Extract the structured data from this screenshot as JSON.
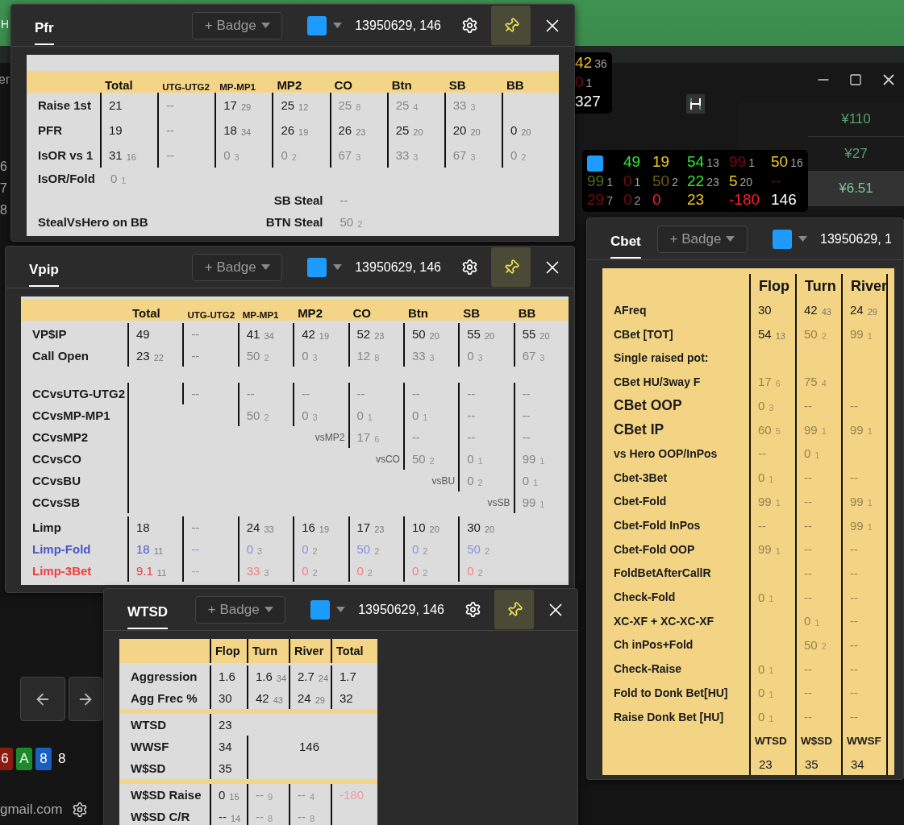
{
  "background": {
    "app_letter": "H",
    "menu_fragment": "er",
    "row_numbers": [
      "6",
      "7",
      "8"
    ],
    "mini_hud": [
      {
        "v": "42",
        "n": "36",
        "color": "#f2c81c"
      },
      {
        "v": "0",
        "n": "1",
        "color": "#8a0c0c"
      },
      {
        "v": "327",
        "color": "#ffffff"
      }
    ],
    "prices": [
      {
        "text": "¥110",
        "selected": false
      },
      {
        "text": "¥27",
        "selected": false
      },
      {
        "text": "¥6.51",
        "selected": true
      }
    ],
    "hud": {
      "rows": [
        [
          {
            "kind": "swatch",
            "color": "#1e9bff"
          },
          {
            "v": "49",
            "color": "#2ee82e"
          },
          {
            "v": "19",
            "color": "#f2c81c"
          },
          {
            "v": "54",
            "n": "13",
            "color": "#2ee82e"
          },
          {
            "v": "99",
            "n": "1",
            "color": "#7a0a0a"
          },
          {
            "v": "50",
            "n": "16",
            "color": "#f2c81c"
          }
        ],
        [
          {
            "v": "99",
            "n": "1",
            "color": "#4d7314"
          },
          {
            "v": "0",
            "n": "1",
            "color": "#7a0a0a"
          },
          {
            "v": "50",
            "n": "2",
            "color": "#6e5e12"
          },
          {
            "v": "22",
            "n": "23",
            "color": "#2ee82e"
          },
          {
            "v": "5",
            "n": "20",
            "color": "#f2c81c"
          },
          {
            "v": "--",
            "color": "#7a0a0a"
          }
        ],
        [
          {
            "v": "29",
            "n": "7",
            "color": "#7a0a0a"
          },
          {
            "v": "0",
            "n": "2",
            "color": "#7a0a0a"
          },
          {
            "v": "0",
            "color": "#ff2020"
          },
          {
            "v": "23",
            "color": "#f2c81c"
          },
          {
            "v": "-180",
            "color": "#ff2020"
          },
          {
            "v": "146",
            "color": "#ffffff"
          }
        ]
      ]
    },
    "cards": [
      {
        "rank": "6",
        "color": "#8b1a10"
      },
      {
        "rank": "A",
        "color": "#1a8a2a"
      },
      {
        "rank": "8",
        "color": "#1a5fc0"
      }
    ],
    "card_count": "8",
    "email": "gmail.com"
  },
  "panels": [
    {
      "kind": "positions",
      "title": "Pfr",
      "badge": "+ Badge",
      "color": "#1e9bff",
      "id_text": "13950629, 146",
      "pinned": true,
      "table": {
        "columns": [
          "Total",
          "UTG-UTG2",
          "MP-MP1",
          "MP2",
          "CO",
          "Btn",
          "SB",
          "BB"
        ],
        "groups": [
          {
            "rows": [
              {
                "label": "Raise 1st",
                "color": "#1a1a1a",
                "cells": [
                  {
                    "kind": "stat",
                    "v": "21",
                    "dim": false
                  },
                  {
                    "kind": "stat",
                    "v": "--",
                    "dim": true
                  },
                  {
                    "kind": "stat",
                    "v": "17",
                    "n": "29",
                    "dim": false
                  },
                  {
                    "kind": "stat",
                    "v": "25",
                    "n": "12",
                    "dim": false
                  },
                  {
                    "kind": "stat",
                    "v": "25",
                    "n": "8",
                    "dim": true
                  },
                  {
                    "kind": "stat",
                    "v": "25",
                    "n": "4",
                    "dim": true
                  },
                  {
                    "kind": "stat",
                    "v": "33",
                    "n": "3",
                    "dim": true
                  },
                  {
                    "kind": "blank"
                  }
                ]
              },
              {
                "label": "PFR",
                "color": "#1a1a1a",
                "cells": [
                  {
                    "kind": "stat",
                    "v": "19",
                    "dim": false
                  },
                  {
                    "kind": "stat",
                    "v": "--",
                    "dim": true
                  },
                  {
                    "kind": "stat",
                    "v": "18",
                    "n": "34",
                    "dim": false
                  },
                  {
                    "kind": "stat",
                    "v": "26",
                    "n": "19",
                    "dim": false
                  },
                  {
                    "kind": "stat",
                    "v": "26",
                    "n": "23",
                    "dim": false
                  },
                  {
                    "kind": "stat",
                    "v": "25",
                    "n": "20",
                    "dim": false
                  },
                  {
                    "kind": "stat",
                    "v": "20",
                    "n": "20",
                    "dim": false
                  },
                  {
                    "kind": "stat",
                    "v": "0",
                    "n": "20",
                    "dim": false
                  }
                ]
              },
              {
                "label": "IsOR vs 1",
                "color": "#1a1a1a",
                "cells": [
                  {
                    "kind": "stat",
                    "v": "31",
                    "n": "16",
                    "dim": false
                  },
                  {
                    "kind": "stat",
                    "v": "--",
                    "dim": true
                  },
                  {
                    "kind": "stat",
                    "v": "0",
                    "n": "3",
                    "dim": true
                  },
                  {
                    "kind": "stat",
                    "v": "0",
                    "n": "2",
                    "dim": true
                  },
                  {
                    "kind": "stat",
                    "v": "67",
                    "n": "3",
                    "dim": true
                  },
                  {
                    "kind": "stat",
                    "v": "33",
                    "n": "3",
                    "dim": true
                  },
                  {
                    "kind": "stat",
                    "v": "67",
                    "n": "3",
                    "dim": true
                  },
                  {
                    "kind": "stat",
                    "v": "0",
                    "n": "2",
                    "dim": true
                  }
                ]
              }
            ]
          }
        ],
        "extras": [
          {
            "left": {
              "label": "IsOR/Fold",
              "v": "0",
              "n": "1",
              "dim": true
            }
          },
          {
            "right": {
              "label": "SB Steal",
              "v": "--",
              "dim": true
            }
          },
          {
            "left": {
              "label": "StealVsHero on BB"
            },
            "right": {
              "label": "BTN Steal",
              "v": "50",
              "n": "2",
              "dim": true
            }
          }
        ]
      }
    },
    {
      "kind": "positions",
      "title": "Vpip",
      "badge": "+ Badge",
      "color": "#1e9bff",
      "id_text": "13950629, 146",
      "pinned": true,
      "table": {
        "columns": [
          "Total",
          "UTG-UTG2",
          "MP-MP1",
          "MP2",
          "CO",
          "Btn",
          "SB",
          "BB"
        ],
        "groups": [
          {
            "rows": [
              {
                "label": "VP$IP",
                "color": "#1a1a1a",
                "cells": [
                  {
                    "kind": "stat",
                    "v": "49",
                    "dim": false
                  },
                  {
                    "kind": "stat",
                    "v": "--",
                    "dim": true
                  },
                  {
                    "kind": "stat",
                    "v": "41",
                    "n": "34",
                    "dim": false
                  },
                  {
                    "kind": "stat",
                    "v": "42",
                    "n": "19",
                    "dim": false
                  },
                  {
                    "kind": "stat",
                    "v": "52",
                    "n": "23",
                    "dim": false
                  },
                  {
                    "kind": "stat",
                    "v": "50",
                    "n": "20",
                    "dim": false
                  },
                  {
                    "kind": "stat",
                    "v": "55",
                    "n": "20",
                    "dim": false
                  },
                  {
                    "kind": "stat",
                    "v": "55",
                    "n": "20",
                    "dim": false
                  }
                ]
              },
              {
                "label": "Call Open",
                "color": "#1a1a1a",
                "cells": [
                  {
                    "kind": "stat",
                    "v": "23",
                    "n": "22",
                    "dim": false
                  },
                  {
                    "kind": "stat",
                    "v": "--",
                    "dim": true
                  },
                  {
                    "kind": "stat",
                    "v": "50",
                    "n": "2",
                    "dim": true
                  },
                  {
                    "kind": "stat",
                    "v": "0",
                    "n": "3",
                    "dim": true
                  },
                  {
                    "kind": "stat",
                    "v": "12",
                    "n": "8",
                    "dim": true
                  },
                  {
                    "kind": "stat",
                    "v": "33",
                    "n": "3",
                    "dim": true
                  },
                  {
                    "kind": "stat",
                    "v": "0",
                    "n": "3",
                    "dim": true
                  },
                  {
                    "kind": "stat",
                    "v": "67",
                    "n": "3",
                    "dim": true
                  }
                ]
              }
            ]
          },
          {
            "rows": [
              {
                "label": "CCvsUTG-UTG2",
                "color": "#1a1a1a",
                "cells": [
                  {
                    "kind": "blank"
                  },
                  {
                    "kind": "stat",
                    "v": "--",
                    "dim": true
                  },
                  {
                    "kind": "stat",
                    "v": "--",
                    "dim": true
                  },
                  {
                    "kind": "stat",
                    "v": "--",
                    "dim": true
                  },
                  {
                    "kind": "stat",
                    "v": "--",
                    "dim": true
                  },
                  {
                    "kind": "stat",
                    "v": "--",
                    "dim": true
                  },
                  {
                    "kind": "stat",
                    "v": "--",
                    "dim": true
                  },
                  {
                    "kind": "stat",
                    "v": "--",
                    "dim": true
                  }
                ]
              },
              {
                "label": "CCvsMP-MP1",
                "color": "#1a1a1a",
                "cells": [
                  {
                    "kind": "blank"
                  },
                  null,
                  {
                    "kind": "stat",
                    "v": "50",
                    "n": "2",
                    "dim": true
                  },
                  {
                    "kind": "stat",
                    "v": "0",
                    "n": "3",
                    "dim": true
                  },
                  {
                    "kind": "stat",
                    "v": "0",
                    "n": "1",
                    "dim": true
                  },
                  {
                    "kind": "stat",
                    "v": "0",
                    "n": "1",
                    "dim": true
                  },
                  {
                    "kind": "stat",
                    "v": "--",
                    "dim": true
                  },
                  {
                    "kind": "stat",
                    "v": "--",
                    "dim": true
                  }
                ]
              },
              {
                "label": "CCvsMP2",
                "color": "#1a1a1a",
                "cells": [
                  {
                    "kind": "blank"
                  },
                  null,
                  null,
                  {
                    "kind": "note",
                    "v": "vsMP2"
                  },
                  {
                    "kind": "stat",
                    "v": "17",
                    "n": "6",
                    "dim": true
                  },
                  {
                    "kind": "stat",
                    "v": "--",
                    "dim": true
                  },
                  {
                    "kind": "stat",
                    "v": "--",
                    "dim": true
                  },
                  {
                    "kind": "stat",
                    "v": "--",
                    "dim": true
                  }
                ]
              },
              {
                "label": "CCvsCO",
                "color": "#1a1a1a",
                "cells": [
                  {
                    "kind": "blank"
                  },
                  null,
                  null,
                  null,
                  {
                    "kind": "note",
                    "v": "vsCO"
                  },
                  {
                    "kind": "stat",
                    "v": "50",
                    "n": "2",
                    "dim": true
                  },
                  {
                    "kind": "stat",
                    "v": "0",
                    "n": "1",
                    "dim": true
                  },
                  {
                    "kind": "stat",
                    "v": "99",
                    "n": "1",
                    "dim": true
                  }
                ]
              },
              {
                "label": "CCvsBU",
                "color": "#1a1a1a",
                "cells": [
                  {
                    "kind": "blank"
                  },
                  null,
                  null,
                  null,
                  null,
                  {
                    "kind": "note",
                    "v": "vsBU"
                  },
                  {
                    "kind": "stat",
                    "v": "0",
                    "n": "2",
                    "dim": true
                  },
                  {
                    "kind": "stat",
                    "v": "0",
                    "n": "1",
                    "dim": true
                  }
                ]
              },
              {
                "label": "CCvsSB",
                "color": "#1a1a1a",
                "cells": [
                  {
                    "kind": "blank"
                  },
                  null,
                  null,
                  null,
                  null,
                  null,
                  {
                    "kind": "note",
                    "v": "vsSB"
                  },
                  {
                    "kind": "stat",
                    "v": "99",
                    "n": "1",
                    "dim": true
                  }
                ]
              }
            ]
          },
          {
            "rows": [
              {
                "label": "Limp",
                "color": "#1a1a1a",
                "cells": [
                  {
                    "kind": "stat",
                    "v": "18",
                    "dim": false
                  },
                  {
                    "kind": "stat",
                    "v": "--",
                    "dim": true
                  },
                  {
                    "kind": "stat",
                    "v": "24",
                    "n": "33",
                    "dim": false
                  },
                  {
                    "kind": "stat",
                    "v": "16",
                    "n": "19",
                    "dim": false
                  },
                  {
                    "kind": "stat",
                    "v": "17",
                    "n": "23",
                    "dim": false
                  },
                  {
                    "kind": "stat",
                    "v": "10",
                    "n": "20",
                    "dim": false
                  },
                  {
                    "kind": "stat",
                    "v": "30",
                    "n": "20",
                    "dim": false
                  },
                  null
                ]
              },
              {
                "label": "Limp-Fold",
                "color": "#4a55c8",
                "cells": [
                  {
                    "kind": "stat",
                    "v": "18",
                    "n": "11",
                    "dim": false
                  },
                  {
                    "kind": "stat",
                    "v": "--",
                    "dim": true
                  },
                  {
                    "kind": "stat",
                    "v": "0",
                    "n": "3",
                    "dim": true
                  },
                  {
                    "kind": "stat",
                    "v": "0",
                    "n": "2",
                    "dim": true
                  },
                  {
                    "kind": "stat",
                    "v": "50",
                    "n": "2",
                    "dim": true
                  },
                  {
                    "kind": "stat",
                    "v": "0",
                    "n": "2",
                    "dim": true
                  },
                  {
                    "kind": "stat",
                    "v": "50",
                    "n": "2",
                    "dim": true
                  },
                  null
                ]
              },
              {
                "label": "Limp-3Bet",
                "color": "#f03c3c",
                "cells": [
                  {
                    "kind": "stat",
                    "v": "9.1",
                    "n": "11",
                    "dim": false
                  },
                  {
                    "kind": "stat",
                    "v": "--",
                    "dim": true
                  },
                  {
                    "kind": "stat",
                    "v": "33",
                    "n": "3",
                    "dim": true
                  },
                  {
                    "kind": "stat",
                    "v": "0",
                    "n": "2",
                    "dim": true
                  },
                  {
                    "kind": "stat",
                    "v": "0",
                    "n": "2",
                    "dim": true
                  },
                  {
                    "kind": "stat",
                    "v": "0",
                    "n": "2",
                    "dim": true
                  },
                  {
                    "kind": "stat",
                    "v": "0",
                    "n": "2",
                    "dim": true
                  },
                  null
                ]
              }
            ]
          }
        ]
      }
    },
    {
      "kind": "streets",
      "title": "WTSD",
      "badge": "+ Badge",
      "color": "#1e9bff",
      "id_text": "13950629, 146",
      "pinned": true,
      "table": {
        "columns": [
          "Flop",
          "Turn",
          "River",
          "Total"
        ],
        "sections": [
          {
            "rows": [
              {
                "label": "Aggression",
                "cells": [
                  {
                    "kind": "stat",
                    "v": "1.6",
                    "dim": false
                  },
                  {
                    "kind": "stat",
                    "v": "1.6",
                    "n": "34",
                    "dim": false
                  },
                  {
                    "kind": "stat",
                    "v": "2.7",
                    "n": "24",
                    "dim": false
                  },
                  {
                    "kind": "stat",
                    "v": "1.7",
                    "dim": false
                  }
                ]
              },
              {
                "label": "Agg Frec %",
                "cells": [
                  {
                    "kind": "stat",
                    "v": "30",
                    "dim": false
                  },
                  {
                    "kind": "stat",
                    "v": "42",
                    "n": "43",
                    "dim": false
                  },
                  {
                    "kind": "stat",
                    "v": "24",
                    "n": "29",
                    "dim": false
                  },
                  {
                    "kind": "stat",
                    "v": "32",
                    "dim": false
                  }
                ]
              }
            ]
          },
          {
            "rows": [
              {
                "label": "WTSD",
                "cells": [
                  {
                    "kind": "stat",
                    "v": "23",
                    "dim": false
                  },
                  null,
                  null,
                  null
                ]
              },
              {
                "label": "WWSF",
                "cells": [
                  {
                    "kind": "stat",
                    "v": "34",
                    "dim": false
                  },
                  {
                    "kind": "blank"
                  },
                  {
                    "kind": "plain",
                    "v": "146",
                    "dim": false
                  },
                  null
                ]
              },
              {
                "label": "W$SD",
                "cells": [
                  {
                    "kind": "stat",
                    "v": "35",
                    "dim": false
                  },
                  {
                    "kind": "blank"
                  },
                  null,
                  null
                ]
              }
            ]
          },
          {
            "rows": [
              {
                "label": "W$SD Raise",
                "cells": [
                  {
                    "kind": "stat",
                    "v": "0",
                    "n": "15",
                    "dim": false
                  },
                  {
                    "kind": "stat",
                    "v": "--",
                    "n": "9",
                    "dim": true
                  },
                  {
                    "kind": "stat",
                    "v": "--",
                    "n": "4",
                    "dim": true
                  },
                  {
                    "kind": "stat",
                    "v": "-180",
                    "dim": true,
                    "color": "#f29a9a"
                  }
                ]
              },
              {
                "label": "W$SD C/R",
                "cells": [
                  {
                    "kind": "stat",
                    "v": "--",
                    "n": "14",
                    "dim": false
                  },
                  {
                    "kind": "stat",
                    "v": "--",
                    "n": "8",
                    "dim": true
                  },
                  {
                    "kind": "stat",
                    "v": "--",
                    "n": "8",
                    "dim": true
                  },
                  {
                    "kind": "blank"
                  }
                ]
              }
            ]
          }
        ]
      }
    },
    {
      "kind": "cbet",
      "title": "Cbet",
      "badge": "+ Badge",
      "color": "#1e9bff",
      "id_text": "13950629, 1",
      "table": {
        "columns": [
          "Flop",
          "Turn",
          "River"
        ],
        "rows": [
          {
            "label": "AFreq",
            "large": false,
            "cells": [
              {
                "kind": "stat",
                "v": "30",
                "dim": false
              },
              {
                "kind": "stat",
                "v": "42",
                "n": "43",
                "dim": false
              },
              {
                "kind": "stat",
                "v": "24",
                "n": "29",
                "dim": false
              }
            ]
          },
          {
            "label": "CBet [TOT]",
            "large": false,
            "cells": [
              {
                "kind": "stat",
                "v": "54",
                "n": "13",
                "dim": false
              },
              {
                "kind": "stat",
                "v": "50",
                "n": "2",
                "dim": true
              },
              {
                "kind": "stat",
                "v": "99",
                "n": "1",
                "dim": true
              }
            ]
          },
          {
            "label": "Single raised pot:",
            "large": false,
            "cells": [
              null,
              null,
              null
            ]
          },
          {
            "label": "CBet HU/3way F",
            "large": false,
            "cells": [
              {
                "kind": "stat",
                "v": "17",
                "n": "6",
                "dim": true
              },
              {
                "kind": "stat",
                "v": "75",
                "n": "4",
                "dim": true
              },
              null
            ]
          },
          {
            "label": "CBet OOP",
            "large": true,
            "cells": [
              {
                "kind": "stat",
                "v": "0",
                "n": "3",
                "dim": true
              },
              {
                "kind": "stat",
                "v": "--",
                "dim": true
              },
              {
                "kind": "stat",
                "v": "--",
                "dim": true
              }
            ]
          },
          {
            "label": "CBet IP",
            "large": true,
            "cells": [
              {
                "kind": "stat",
                "v": "60",
                "n": "5",
                "dim": true
              },
              {
                "kind": "stat",
                "v": "99",
                "n": "1",
                "dim": true
              },
              {
                "kind": "stat",
                "v": "99",
                "n": "1",
                "dim": true
              }
            ]
          },
          {
            "label": "vs Hero OOP/InPos",
            "large": false,
            "cells": [
              {
                "kind": "stat",
                "v": "--",
                "dim": true
              },
              {
                "kind": "stat",
                "v": "0",
                "n": "1",
                "dim": true
              },
              null
            ]
          },
          {
            "label": "Cbet-3Bet",
            "large": false,
            "cells": [
              {
                "kind": "stat",
                "v": "0",
                "n": "1",
                "dim": true
              },
              {
                "kind": "stat",
                "v": "--",
                "dim": true
              },
              {
                "kind": "stat",
                "v": "--",
                "dim": true
              }
            ]
          },
          {
            "label": "Cbet-Fold",
            "large": false,
            "cells": [
              {
                "kind": "stat",
                "v": "99",
                "n": "1",
                "dim": true
              },
              {
                "kind": "stat",
                "v": "--",
                "dim": true
              },
              {
                "kind": "stat",
                "v": "99",
                "n": "1",
                "dim": true
              }
            ]
          },
          {
            "label": "Cbet-Fold InPos",
            "large": false,
            "cells": [
              {
                "kind": "stat",
                "v": "--",
                "dim": true
              },
              {
                "kind": "stat",
                "v": "--",
                "dim": true
              },
              {
                "kind": "stat",
                "v": "99",
                "n": "1",
                "dim": true
              }
            ]
          },
          {
            "label": "Cbet-Fold OOP",
            "large": false,
            "cells": [
              {
                "kind": "stat",
                "v": "99",
                "n": "1",
                "dim": true
              },
              {
                "kind": "stat",
                "v": "--",
                "dim": true
              },
              {
                "kind": "stat",
                "v": "--",
                "dim": true
              }
            ]
          },
          {
            "label": "FoldBetAfterCallR",
            "large": false,
            "cells": [
              null,
              {
                "kind": "stat",
                "v": "--",
                "dim": true
              },
              {
                "kind": "stat",
                "v": "--",
                "dim": true
              }
            ]
          },
          {
            "label": "Check-Fold",
            "large": false,
            "cells": [
              {
                "kind": "stat",
                "v": "0",
                "n": "1",
                "dim": true
              },
              {
                "kind": "stat",
                "v": "--",
                "dim": true
              },
              {
                "kind": "stat",
                "v": "--",
                "dim": true
              }
            ]
          },
          {
            "label": "XC-XF + XC-XC-XF",
            "large": false,
            "cells": [
              null,
              {
                "kind": "stat",
                "v": "0",
                "n": "1",
                "dim": true
              },
              {
                "kind": "stat",
                "v": "--",
                "dim": true
              }
            ]
          },
          {
            "label": "Ch inPos+Fold",
            "large": false,
            "cells": [
              null,
              {
                "kind": "stat",
                "v": "50",
                "n": "2",
                "dim": true
              },
              {
                "kind": "stat",
                "v": "--",
                "dim": true
              }
            ]
          },
          {
            "label": "Check-Raise",
            "large": false,
            "cells": [
              {
                "kind": "stat",
                "v": "0",
                "n": "1",
                "dim": true
              },
              {
                "kind": "stat",
                "v": "--",
                "dim": true
              },
              {
                "kind": "stat",
                "v": "--",
                "dim": true
              }
            ]
          },
          {
            "label": "Fold to Donk Bet[HU]",
            "large": false,
            "cells": [
              {
                "kind": "stat",
                "v": "0",
                "n": "1",
                "dim": true
              },
              {
                "kind": "stat",
                "v": "--",
                "dim": true
              },
              {
                "kind": "stat",
                "v": "--",
                "dim": true
              }
            ]
          },
          {
            "label": "Raise Donk Bet [HU]",
            "large": false,
            "cells": [
              {
                "kind": "stat",
                "v": "0",
                "n": "1",
                "dim": true
              },
              {
                "kind": "stat",
                "v": "--",
                "dim": true
              },
              {
                "kind": "stat",
                "v": "--",
                "dim": true
              }
            ]
          }
        ],
        "footer": {
          "labels": [
            "WTSD",
            "W$SD",
            "WWSF"
          ],
          "values": [
            "23",
            "35",
            "34"
          ]
        }
      }
    }
  ]
}
